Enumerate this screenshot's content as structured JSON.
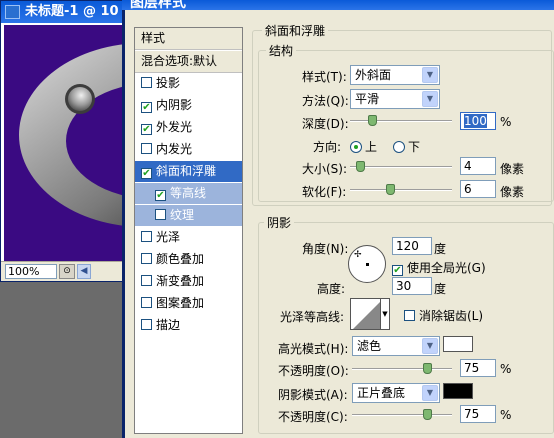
{
  "document": {
    "title": "未标题-1 @ 10",
    "zoom": "100%",
    "nav_icon": "navigator-icon",
    "left_arrow": "◀"
  },
  "dialog": {
    "title": "图层样式"
  },
  "style_list": {
    "items": [
      {
        "label": "样式",
        "type": "header"
      },
      {
        "label": "混合选项:默认",
        "type": "header"
      },
      {
        "label": "投影",
        "checked": false
      },
      {
        "label": "内阴影",
        "checked": true
      },
      {
        "label": "外发光",
        "checked": true
      },
      {
        "label": "内发光",
        "checked": false
      },
      {
        "label": "斜面和浮雕",
        "checked": true,
        "selected": true
      },
      {
        "label": "等高线",
        "checked": true,
        "sub": true
      },
      {
        "label": "纹理",
        "checked": false,
        "sub": true
      },
      {
        "label": "光泽",
        "checked": false
      },
      {
        "label": "颜色叠加",
        "checked": false
      },
      {
        "label": "渐变叠加",
        "checked": false
      },
      {
        "label": "图案叠加",
        "checked": false
      },
      {
        "label": "描边",
        "checked": false
      }
    ]
  },
  "bevel": {
    "section_title": "斜面和浮雕",
    "structure_title": "结构",
    "style_label": "样式(T):",
    "style_value": "外斜面",
    "technique_label": "方法(Q):",
    "technique_value": "平滑",
    "depth_label": "深度(D):",
    "depth_value": "100",
    "depth_unit": "%",
    "depth_level": 0.1,
    "direction_label": "方向:",
    "direction_up": "上",
    "direction_down": "下",
    "size_label": "大小(S):",
    "size_value": "4",
    "size_unit": "像素",
    "soften_label": "软化(F):",
    "soften_value": "6",
    "soften_unit": "像素"
  },
  "shading": {
    "section_title": "阴影",
    "angle_label": "角度(N):",
    "angle_value": "120",
    "angle_unit": "度",
    "global_light_label": "使用全局光(G)",
    "global_light_checked": true,
    "altitude_label": "高度:",
    "altitude_value": "30",
    "altitude_unit": "度",
    "gloss_contour_label": "光泽等高线:",
    "anti_alias_label": "消除锯齿(L)",
    "anti_alias_checked": false,
    "highlight_mode_label": "高光模式(H):",
    "highlight_mode_value": "滤色",
    "highlight_color": "#ffffff",
    "highlight_opacity_label": "不透明度(O):",
    "highlight_opacity_value": "75",
    "highlight_opacity_unit": "%",
    "shadow_mode_label": "阴影模式(A):",
    "shadow_mode_value": "正片叠底",
    "shadow_color": "#000000",
    "shadow_opacity_label": "不透明度(C):",
    "shadow_opacity_value": "75",
    "shadow_opacity_unit": "%"
  }
}
